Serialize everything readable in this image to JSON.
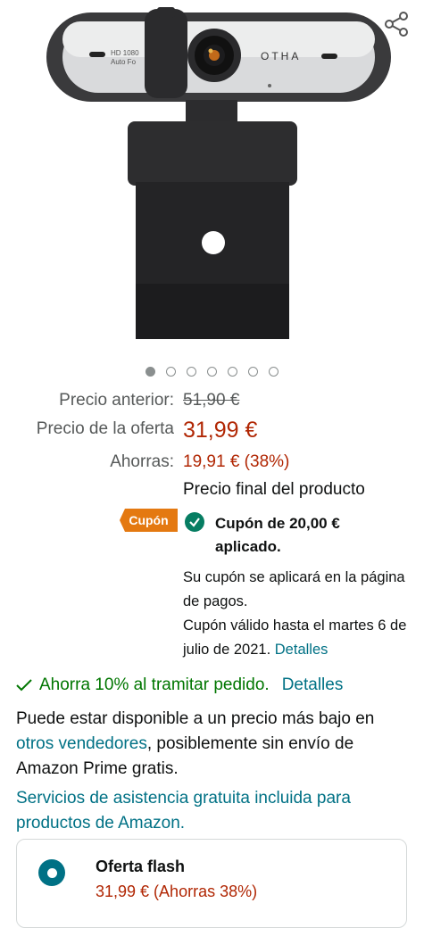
{
  "product": {
    "brand_text": "OTHA",
    "lens_text_1": "HD 1080",
    "lens_text_2": "Auto Fo"
  },
  "carousel": {
    "total": 7,
    "active": 1
  },
  "prices": {
    "previous_label": "Precio anterior:",
    "previous_value": "51,90 €",
    "deal_label": "Precio de la oferta",
    "deal_value": "31,99 €",
    "savings_label": "Ahorras:",
    "savings_value": "19,91 € (38%)",
    "final_note": "Precio final del producto"
  },
  "coupon": {
    "badge": "Cupón",
    "applied_text": "Cupón de 20,00 € aplicado.",
    "info_1": "Su cupón se aplicará en la página de pagos.",
    "info_2": "Cupón válido hasta el martes 6 de julio de 2021.",
    "details_link": "Detalles"
  },
  "extra_savings": {
    "text": "Ahorra 10% al tramitar pedido.",
    "link": "Detalles"
  },
  "other_sellers": {
    "text_before": "Puede estar disponible a un precio más bajo en ",
    "link": "otros vendedores",
    "text_after": ", posiblemente sin envío de Amazon Prime gratis."
  },
  "services_link": "Servicios de asistencia gratuita incluida para productos de Amazon.",
  "flash_offer": {
    "title": "Oferta flash",
    "price": "31,99 € (Ahorras 38%)"
  },
  "colors": {
    "price_red": "#b12704",
    "link_teal": "#007185",
    "coupon_orange": "#e47911",
    "success_green": "#007600"
  }
}
